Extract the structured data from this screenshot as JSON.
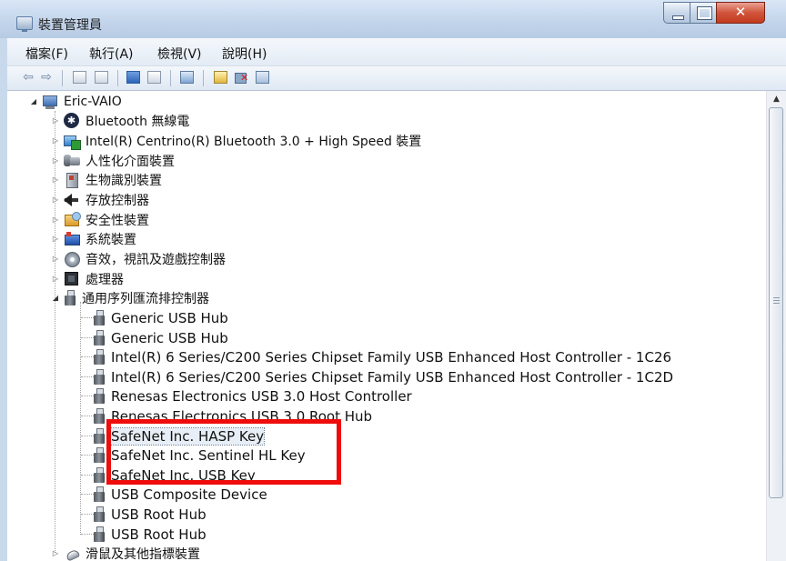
{
  "window": {
    "title": "裝置管理員"
  },
  "menu": [
    "檔案(F)",
    "執行(A)",
    "檢視(V)",
    "說明(H)"
  ],
  "toolbar": {
    "buttons": [
      "back-icon",
      "forward-icon",
      "properties-window-icon",
      "show-hidden-icon",
      "help-icon",
      "view-icon",
      "monitor-icon",
      "update-driver-icon",
      "uninstall-icon",
      "scan-hardware-icon"
    ]
  },
  "tree": {
    "root": "Eric-VAIO",
    "categories": [
      {
        "label": "Bluetooth 無線電",
        "icon": "bluetooth-icon"
      },
      {
        "label": "Intel(R) Centrino(R) Bluetooth 3.0 + High Speed 裝置",
        "icon": "network-device-icon"
      },
      {
        "label": "人性化介面裝置",
        "icon": "hid-icon"
      },
      {
        "label": "生物識別裝置",
        "icon": "biometric-icon"
      },
      {
        "label": "存放控制器",
        "icon": "storage-controller-icon"
      },
      {
        "label": "安全性裝置",
        "icon": "security-device-icon"
      },
      {
        "label": "系統裝置",
        "icon": "system-device-icon"
      },
      {
        "label": "音效，視訊及遊戲控制器",
        "icon": "sound-icon"
      },
      {
        "label": "處理器",
        "icon": "processor-icon"
      },
      {
        "label": "通用序列匯流排控制器",
        "icon": "usb-icon"
      }
    ],
    "usb_children": [
      "Generic USB Hub",
      "Generic USB Hub",
      "Intel(R) 6 Series/C200 Series Chipset Family USB Enhanced Host Controller - 1C26",
      "Intel(R) 6 Series/C200 Series Chipset Family USB Enhanced Host Controller - 1C2D",
      "Renesas Electronics USB 3.0 Host Controller",
      "Renesas Electronics USB 3.0 Root Hub",
      "SafeNet Inc. HASP Key",
      "SafeNet Inc. Sentinel HL Key",
      "SafeNet Inc. USB Key",
      "USB Composite Device",
      "USB Root Hub",
      "USB Root Hub"
    ],
    "last_category": {
      "label": "滑鼠及其他指標裝置",
      "icon": "mouse-icon"
    }
  },
  "highlight_color": "#ef0c0c"
}
